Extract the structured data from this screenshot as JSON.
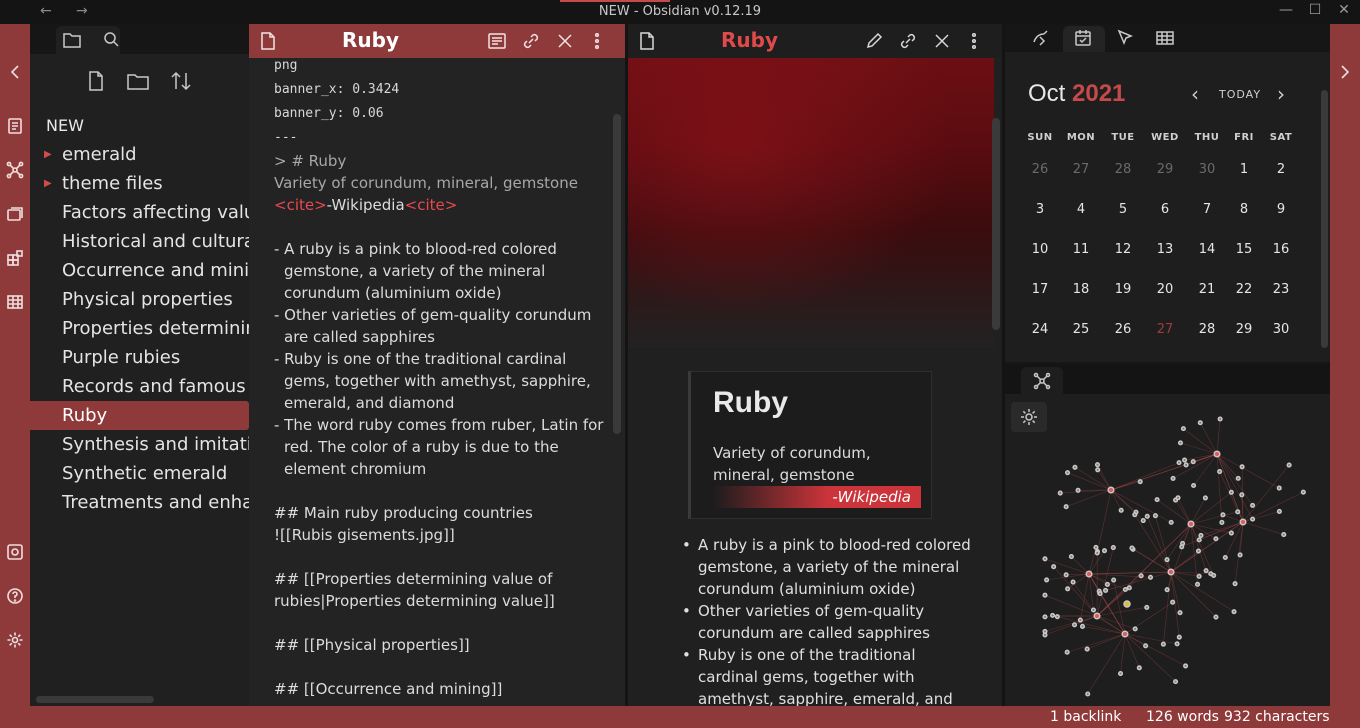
{
  "window": {
    "title": "NEW - Obsidian v0.12.19",
    "back_glyph": "←",
    "forward_glyph": "→",
    "minimize_glyph": "—",
    "maximize_glyph": "☐",
    "close_glyph": "✕"
  },
  "theme": {
    "accent": "#8f3a3a",
    "accent_text": "#e04a4a",
    "background": "#1c1c1e"
  },
  "explorer": {
    "vault_name": "NEW",
    "items": [
      {
        "label": "emerald",
        "type": "folder"
      },
      {
        "label": "theme files",
        "type": "folder"
      },
      {
        "label": "Factors affecting value",
        "type": "file"
      },
      {
        "label": "Historical and cultural",
        "type": "file"
      },
      {
        "label": "Occurrence and mining",
        "type": "file"
      },
      {
        "label": "Physical properties",
        "type": "file"
      },
      {
        "label": "Properties determining value of rubies",
        "type": "file"
      },
      {
        "label": "Purple rubies",
        "type": "file"
      },
      {
        "label": "Records and famous examples",
        "type": "file"
      },
      {
        "label": "Ruby",
        "type": "file",
        "active": true
      },
      {
        "label": "Synthesis and imitation",
        "type": "file"
      },
      {
        "label": "Synthetic emerald",
        "type": "file"
      },
      {
        "label": "Treatments and enhancements",
        "type": "file"
      }
    ]
  },
  "editor": {
    "title": "Ruby",
    "frontmatter": [
      "png",
      "banner_x: 0.3424",
      "banner_y: 0.06",
      "---"
    ],
    "quote_heading": "> # Ruby",
    "quote_text": "Variety of corundum, mineral, gemstone",
    "cite_open": "<cite>",
    "cite_text": "-Wikipedia",
    "cite_close": "<cite>",
    "bullets": [
      "- A ruby is a pink to blood-red colored gemstone, a variety of the mineral corundum (aluminium oxide)",
      "- Other varieties of gem-quality corundum are called sapphires",
      "- Ruby is one of the traditional cardinal gems, together with amethyst, sapphire, emerald, and diamond",
      "- The word ruby comes from ruber, Latin for red. The color of a ruby is due to the element chromium"
    ],
    "section1": "## Main ruby producing countries",
    "embed": "![[Rubis gisements.jpg]]",
    "section2": "## [[Properties determining value of rubies|Properties determining value]]",
    "section3": "## [[Physical properties]]",
    "section4": "## [[Occurrence and mining]]"
  },
  "preview": {
    "title": "Ruby",
    "callout_title": "Ruby",
    "callout_body": "Variety of corundum, mineral, gemstone",
    "callout_cite": "-Wikipedia",
    "bullets": [
      "A ruby is a pink to blood-red colored gemstone, a variety of the mineral corundum (aluminium oxide)",
      "Other varieties of gem-quality corundum are called sapphires",
      "Ruby is one of the traditional cardinal gems, together with amethyst, sapphire, emerald, and diamond"
    ]
  },
  "calendar": {
    "month": "Oct",
    "year": "2021",
    "today_label": "TODAY",
    "weekdays": [
      "SUN",
      "MON",
      "TUE",
      "WED",
      "THU",
      "FRI",
      "SAT"
    ],
    "weeks": [
      [
        "26",
        "27",
        "28",
        "29",
        "30",
        "1",
        "2"
      ],
      [
        "3",
        "4",
        "5",
        "6",
        "7",
        "8",
        "9"
      ],
      [
        "10",
        "11",
        "12",
        "13",
        "14",
        "15",
        "16"
      ],
      [
        "17",
        "18",
        "19",
        "20",
        "21",
        "22",
        "23"
      ],
      [
        "24",
        "25",
        "26",
        "27",
        "28",
        "29",
        "30"
      ]
    ],
    "muted_first_row_count": 5,
    "today_day": "27"
  },
  "status": {
    "backlinks": "1 backlink",
    "words": "126 words",
    "characters": "932 characters"
  }
}
